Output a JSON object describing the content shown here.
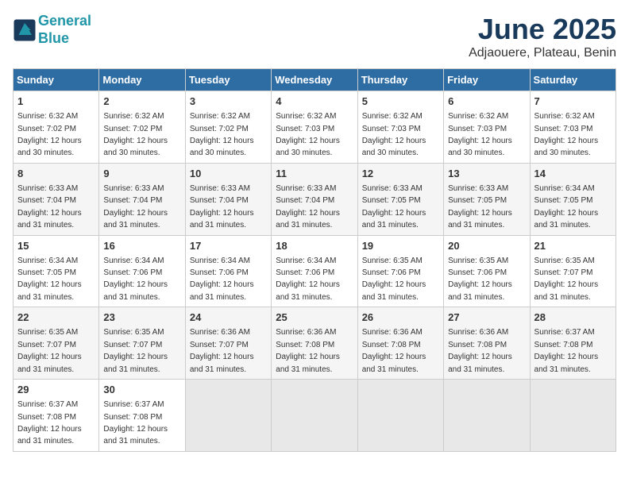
{
  "logo": {
    "line1": "General",
    "line2": "Blue"
  },
  "title": "June 2025",
  "subtitle": "Adjaouere, Plateau, Benin",
  "days_of_week": [
    "Sunday",
    "Monday",
    "Tuesday",
    "Wednesday",
    "Thursday",
    "Friday",
    "Saturday"
  ],
  "weeks": [
    [
      {
        "day": "1",
        "sunrise": "Sunrise: 6:32 AM",
        "sunset": "Sunset: 7:02 PM",
        "daylight": "Daylight: 12 hours and 30 minutes."
      },
      {
        "day": "2",
        "sunrise": "Sunrise: 6:32 AM",
        "sunset": "Sunset: 7:02 PM",
        "daylight": "Daylight: 12 hours and 30 minutes."
      },
      {
        "day": "3",
        "sunrise": "Sunrise: 6:32 AM",
        "sunset": "Sunset: 7:02 PM",
        "daylight": "Daylight: 12 hours and 30 minutes."
      },
      {
        "day": "4",
        "sunrise": "Sunrise: 6:32 AM",
        "sunset": "Sunset: 7:03 PM",
        "daylight": "Daylight: 12 hours and 30 minutes."
      },
      {
        "day": "5",
        "sunrise": "Sunrise: 6:32 AM",
        "sunset": "Sunset: 7:03 PM",
        "daylight": "Daylight: 12 hours and 30 minutes."
      },
      {
        "day": "6",
        "sunrise": "Sunrise: 6:32 AM",
        "sunset": "Sunset: 7:03 PM",
        "daylight": "Daylight: 12 hours and 30 minutes."
      },
      {
        "day": "7",
        "sunrise": "Sunrise: 6:32 AM",
        "sunset": "Sunset: 7:03 PM",
        "daylight": "Daylight: 12 hours and 30 minutes."
      }
    ],
    [
      {
        "day": "8",
        "sunrise": "Sunrise: 6:33 AM",
        "sunset": "Sunset: 7:04 PM",
        "daylight": "Daylight: 12 hours and 31 minutes."
      },
      {
        "day": "9",
        "sunrise": "Sunrise: 6:33 AM",
        "sunset": "Sunset: 7:04 PM",
        "daylight": "Daylight: 12 hours and 31 minutes."
      },
      {
        "day": "10",
        "sunrise": "Sunrise: 6:33 AM",
        "sunset": "Sunset: 7:04 PM",
        "daylight": "Daylight: 12 hours and 31 minutes."
      },
      {
        "day": "11",
        "sunrise": "Sunrise: 6:33 AM",
        "sunset": "Sunset: 7:04 PM",
        "daylight": "Daylight: 12 hours and 31 minutes."
      },
      {
        "day": "12",
        "sunrise": "Sunrise: 6:33 AM",
        "sunset": "Sunset: 7:05 PM",
        "daylight": "Daylight: 12 hours and 31 minutes."
      },
      {
        "day": "13",
        "sunrise": "Sunrise: 6:33 AM",
        "sunset": "Sunset: 7:05 PM",
        "daylight": "Daylight: 12 hours and 31 minutes."
      },
      {
        "day": "14",
        "sunrise": "Sunrise: 6:34 AM",
        "sunset": "Sunset: 7:05 PM",
        "daylight": "Daylight: 12 hours and 31 minutes."
      }
    ],
    [
      {
        "day": "15",
        "sunrise": "Sunrise: 6:34 AM",
        "sunset": "Sunset: 7:05 PM",
        "daylight": "Daylight: 12 hours and 31 minutes."
      },
      {
        "day": "16",
        "sunrise": "Sunrise: 6:34 AM",
        "sunset": "Sunset: 7:06 PM",
        "daylight": "Daylight: 12 hours and 31 minutes."
      },
      {
        "day": "17",
        "sunrise": "Sunrise: 6:34 AM",
        "sunset": "Sunset: 7:06 PM",
        "daylight": "Daylight: 12 hours and 31 minutes."
      },
      {
        "day": "18",
        "sunrise": "Sunrise: 6:34 AM",
        "sunset": "Sunset: 7:06 PM",
        "daylight": "Daylight: 12 hours and 31 minutes."
      },
      {
        "day": "19",
        "sunrise": "Sunrise: 6:35 AM",
        "sunset": "Sunset: 7:06 PM",
        "daylight": "Daylight: 12 hours and 31 minutes."
      },
      {
        "day": "20",
        "sunrise": "Sunrise: 6:35 AM",
        "sunset": "Sunset: 7:06 PM",
        "daylight": "Daylight: 12 hours and 31 minutes."
      },
      {
        "day": "21",
        "sunrise": "Sunrise: 6:35 AM",
        "sunset": "Sunset: 7:07 PM",
        "daylight": "Daylight: 12 hours and 31 minutes."
      }
    ],
    [
      {
        "day": "22",
        "sunrise": "Sunrise: 6:35 AM",
        "sunset": "Sunset: 7:07 PM",
        "daylight": "Daylight: 12 hours and 31 minutes."
      },
      {
        "day": "23",
        "sunrise": "Sunrise: 6:35 AM",
        "sunset": "Sunset: 7:07 PM",
        "daylight": "Daylight: 12 hours and 31 minutes."
      },
      {
        "day": "24",
        "sunrise": "Sunrise: 6:36 AM",
        "sunset": "Sunset: 7:07 PM",
        "daylight": "Daylight: 12 hours and 31 minutes."
      },
      {
        "day": "25",
        "sunrise": "Sunrise: 6:36 AM",
        "sunset": "Sunset: 7:08 PM",
        "daylight": "Daylight: 12 hours and 31 minutes."
      },
      {
        "day": "26",
        "sunrise": "Sunrise: 6:36 AM",
        "sunset": "Sunset: 7:08 PM",
        "daylight": "Daylight: 12 hours and 31 minutes."
      },
      {
        "day": "27",
        "sunrise": "Sunrise: 6:36 AM",
        "sunset": "Sunset: 7:08 PM",
        "daylight": "Daylight: 12 hours and 31 minutes."
      },
      {
        "day": "28",
        "sunrise": "Sunrise: 6:37 AM",
        "sunset": "Sunset: 7:08 PM",
        "daylight": "Daylight: 12 hours and 31 minutes."
      }
    ],
    [
      {
        "day": "29",
        "sunrise": "Sunrise: 6:37 AM",
        "sunset": "Sunset: 7:08 PM",
        "daylight": "Daylight: 12 hours and 31 minutes."
      },
      {
        "day": "30",
        "sunrise": "Sunrise: 6:37 AM",
        "sunset": "Sunset: 7:08 PM",
        "daylight": "Daylight: 12 hours and 31 minutes."
      },
      {
        "day": "",
        "sunrise": "",
        "sunset": "",
        "daylight": ""
      },
      {
        "day": "",
        "sunrise": "",
        "sunset": "",
        "daylight": ""
      },
      {
        "day": "",
        "sunrise": "",
        "sunset": "",
        "daylight": ""
      },
      {
        "day": "",
        "sunrise": "",
        "sunset": "",
        "daylight": ""
      },
      {
        "day": "",
        "sunrise": "",
        "sunset": "",
        "daylight": ""
      }
    ]
  ]
}
